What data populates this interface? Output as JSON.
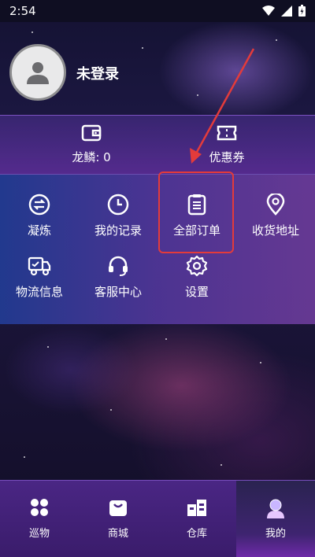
{
  "status_bar": {
    "time": "2:54"
  },
  "profile": {
    "username": "未登录"
  },
  "wallet": {
    "balance_label": "龙鳞: 0",
    "coupons_label": "优惠券"
  },
  "menu": {
    "items": [
      {
        "label": "凝炼",
        "icon": "exchange-icon"
      },
      {
        "label": "我的记录",
        "icon": "clock-icon"
      },
      {
        "label": "全部订单",
        "icon": "clipboard-icon"
      },
      {
        "label": "收货地址",
        "icon": "location-pin-icon"
      },
      {
        "label": "物流信息",
        "icon": "truck-icon"
      },
      {
        "label": "客服中心",
        "icon": "headset-icon"
      },
      {
        "label": "设置",
        "icon": "gear-icon"
      }
    ]
  },
  "bottom_nav": {
    "items": [
      {
        "label": "巡物",
        "icon": "grid-icon",
        "active": false
      },
      {
        "label": "商城",
        "icon": "shopping-bag-icon",
        "active": false
      },
      {
        "label": "仓库",
        "icon": "warehouse-icon",
        "active": false
      },
      {
        "label": "我的",
        "icon": "profile-icon",
        "active": true
      }
    ]
  },
  "colors": {
    "highlight": "#e33b3b",
    "nav_background": "#4a2684",
    "panel_blue": "#2341a0",
    "panel_purple": "#8246b4"
  }
}
